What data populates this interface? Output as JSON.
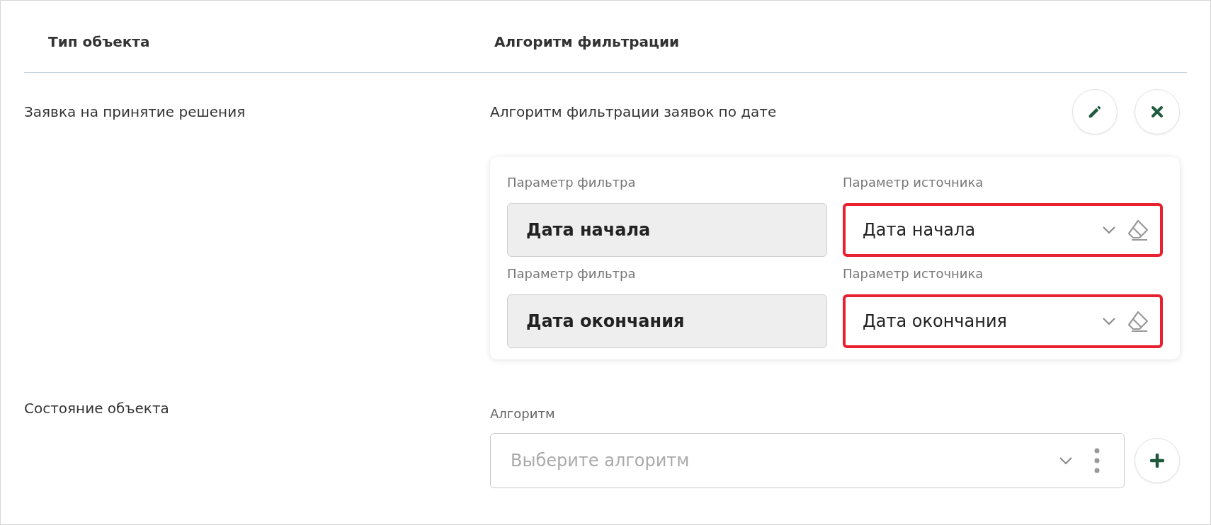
{
  "columns": [
    {
      "label": "Тип объекта"
    },
    {
      "label": "Алгоритм фильтрации"
    }
  ],
  "rows": [
    {
      "object_type": "Заявка на принятие решения",
      "kind": "assigned",
      "algorithm": "Алгоритм фильтрации заявок по дате",
      "actions": [
        {
          "kind": "edit"
        },
        {
          "kind": "delete"
        }
      ],
      "parameters": [
        {
          "filter_label": "Параметр фильтра",
          "filter_value": "Дата начала",
          "source_label": "Параметр источника",
          "source_value": "Дата начала",
          "source_error": true
        },
        {
          "filter_label": "Параметр фильтра",
          "filter_value": "Дата окончания",
          "source_label": "Параметр источника",
          "source_value": "Дата окончания",
          "source_error": true
        }
      ]
    },
    {
      "object_type": "Состояние объекта",
      "kind": "select",
      "select": {
        "label": "Алгоритм",
        "placeholder": "Выберите алгоритм"
      },
      "actions": [
        {
          "kind": "add"
        }
      ]
    }
  ]
}
